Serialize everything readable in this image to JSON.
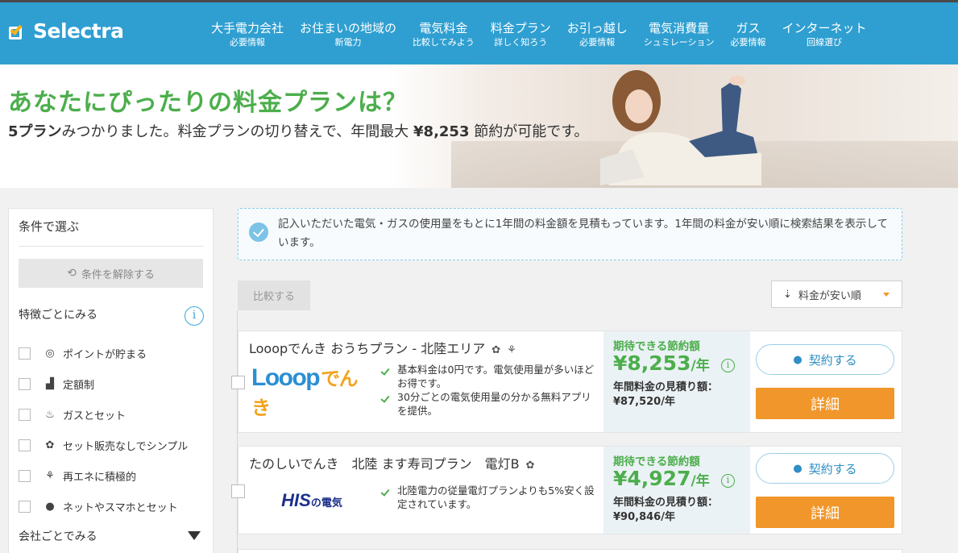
{
  "header": {
    "logo": "Selectra",
    "nav": [
      {
        "title": "大手電力会社",
        "sub": "必要情報"
      },
      {
        "title": "お住まいの地域の",
        "sub": "新電力"
      },
      {
        "title": "電気料金",
        "sub": "比較してみよう"
      },
      {
        "title": "料金プラン",
        "sub": "詳しく知ろう"
      },
      {
        "title": "お引っ越し",
        "sub": "必要情報"
      },
      {
        "title": "電気消費量",
        "sub": "シュミレーション"
      },
      {
        "title": "ガス",
        "sub": "必要情報"
      },
      {
        "title": "インターネット",
        "sub": "回線選び"
      }
    ]
  },
  "hero": {
    "title": "あなたにぴったりの料金プランは？",
    "count": "5プラン",
    "sub_part1": "みつかりました。料金プランの切り替えで、年間最大",
    "max_saving": "¥8,253",
    "sub_part2": "節約が可能です。"
  },
  "sidebar": {
    "title": "条件で選ぶ",
    "clear_label": "条件を解除する",
    "feature_heading": "特徴ごとにみる",
    "items": [
      {
        "label": "ポイントが貯まる",
        "icon": "coin-icon"
      },
      {
        "label": "定額制",
        "icon": "chart-icon"
      },
      {
        "label": "ガスとセット",
        "icon": "flame-icon"
      },
      {
        "label": "セット販売なしでシンプル",
        "icon": "flower-icon"
      },
      {
        "label": "再エネに積極的",
        "icon": "wind-icon"
      },
      {
        "label": "ネットやスマホとセット",
        "icon": "mouse-icon"
      }
    ],
    "company_heading": "会社ごとでみる"
  },
  "notice": {
    "text": "記入いただいた電気・ガスの使用量をもとに1年間の料金額を見積もっています。1年間の料金が安い順に検索結果を表示しています。"
  },
  "toolbar": {
    "compare_label": "比較する",
    "sort_label": "料金が安い順"
  },
  "plans": [
    {
      "name": "Looopでんき おうちプラン - 北陸エリア",
      "logo_main": "Looop",
      "logo_sub": "でんき",
      "features": [
        "基本料金は0円です。電気使用量が多いほどお得です。",
        "30分ごとの電気使用量の分かる無料アプリを提供。"
      ],
      "saving_label": "期待できる節約額",
      "saving": "¥8,253",
      "per_year": "/年",
      "estimate_label": "年間料金の見積り額：",
      "estimate": "¥87,520/年",
      "contract_label": "契約する",
      "detail_label": "詳細"
    },
    {
      "name": "たのしいでんき　北陸 ます寿司プラン　電灯B",
      "logo_main": "HIS",
      "logo_sub": "の電気",
      "features": [
        "北陸電力の従量電灯プランよりも5%安く設定されています。"
      ],
      "saving_label": "期待できる節約額",
      "saving": "¥4,927",
      "per_year": "/年",
      "estimate_label": "年間料金の見積り額：",
      "estimate": "¥90,846/年",
      "contract_label": "契約する",
      "detail_label": "詳細"
    }
  ],
  "colors": {
    "header_bg": "#2f9fd1",
    "accent_green": "#4cae4c",
    "detail_orange": "#f0962a"
  }
}
